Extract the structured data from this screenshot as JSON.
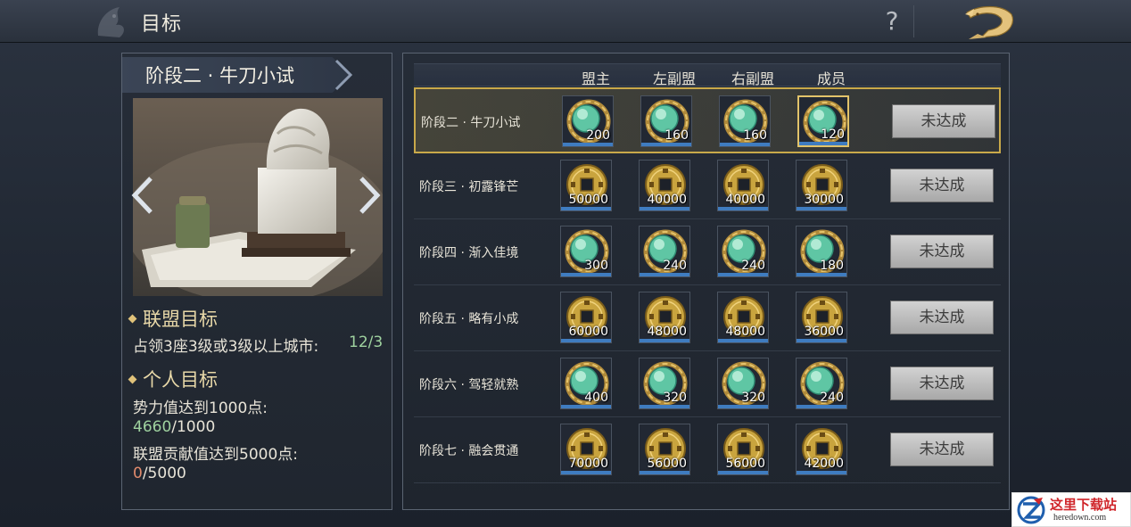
{
  "header": {
    "title": "目标",
    "help_label": "?"
  },
  "stage": {
    "title": "阶段二 · 牛刀小试"
  },
  "alliance_goal": {
    "heading": "联盟目标",
    "requirement": "占领3座3级或3级以上城市:",
    "progress": "12/3"
  },
  "personal_goal": {
    "heading": "个人目标",
    "req1": "势力值达到1000点:",
    "req1_current": "4660",
    "req1_total": "/1000",
    "req2": "联盟贡献值达到5000点:",
    "req2_current": "0",
    "req2_total": "/5000"
  },
  "columns": [
    "盟主",
    "左副盟",
    "右副盟",
    "成员"
  ],
  "rows": [
    {
      "label": "阶段二 · 牛刀小试",
      "item": "jade",
      "qty": [
        "200",
        "160",
        "160",
        "120"
      ],
      "status": "未达成"
    },
    {
      "label": "阶段三 · 初露锋芒",
      "item": "coin",
      "qty": [
        "50000",
        "40000",
        "40000",
        "30000"
      ],
      "status": "未达成"
    },
    {
      "label": "阶段四 · 渐入佳境",
      "item": "jade",
      "qty": [
        "300",
        "240",
        "240",
        "180"
      ],
      "status": "未达成"
    },
    {
      "label": "阶段五 · 略有小成",
      "item": "coin",
      "qty": [
        "60000",
        "48000",
        "48000",
        "36000"
      ],
      "status": "未达成"
    },
    {
      "label": "阶段六 · 驾轻就熟",
      "item": "jade",
      "qty": [
        "400",
        "320",
        "320",
        "240"
      ],
      "status": "未达成"
    },
    {
      "label": "阶段七 · 融会贯通",
      "item": "coin",
      "qty": [
        "70000",
        "56000",
        "56000",
        "42000"
      ],
      "status": "未达成"
    }
  ],
  "colors": {
    "accent_gold": "#c9a94a",
    "progress_green": "#9fd29f",
    "progress_red": "#e08a6c",
    "qty_bar_blue": "#3f7cc0"
  },
  "icons": {
    "jade": "jade-orb-icon",
    "coin": "copper-coin-icon"
  },
  "watermark": {
    "title": "这里下载站",
    "sub": "heredown.com"
  }
}
